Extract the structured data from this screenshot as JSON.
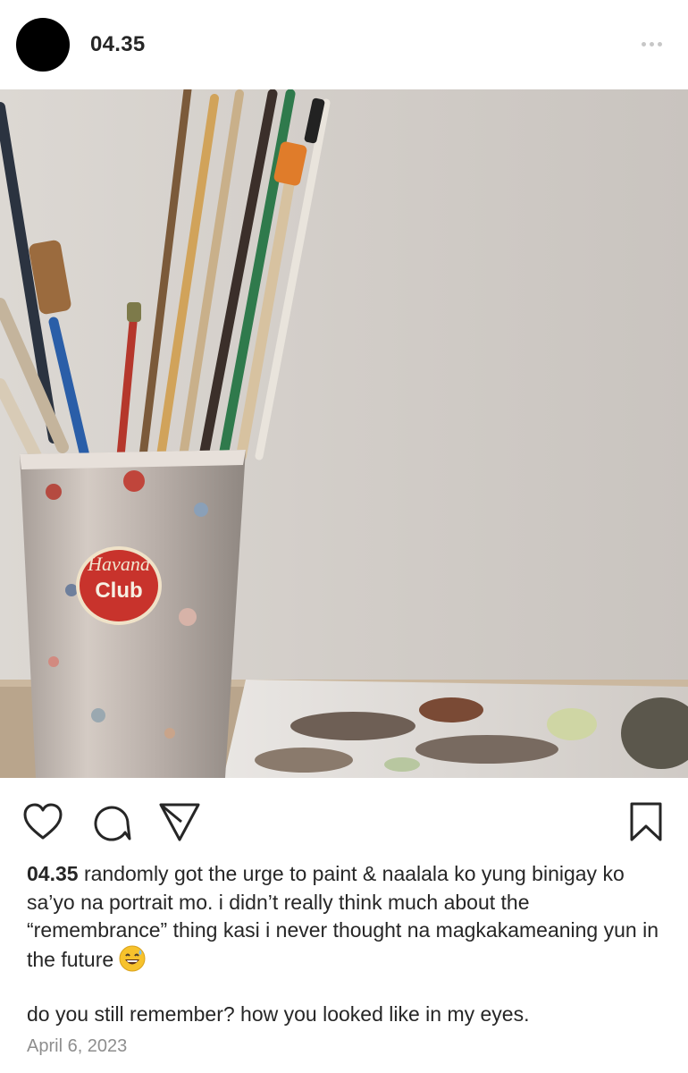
{
  "post": {
    "username": "04.35",
    "caption_username": "04.35",
    "caption_text": "randomly got the urge to paint & naalala ko yung binigay ko sa’yo na portrait mo. i didn’t really think much about the “remembrance” thing kasi i never thought na magkakameaning yun in the future",
    "caption_emoji": "grinning-face-with-sweat-emoji",
    "caption_followup": "do you still remember? how you looked like in my eyes.",
    "date": "April 6, 2023"
  },
  "photo": {
    "subject": "paintbrushes in a paint-splattered cup with a palette",
    "cup_logo_line1": "Havana",
    "cup_logo_line2": "Club"
  },
  "icons": {
    "more": "more-options-icon",
    "like": "heart-icon",
    "comment": "comment-bubble-icon",
    "share": "paper-plane-icon",
    "save": "bookmark-icon"
  },
  "colors": {
    "text": "#262626",
    "secondary": "#8e8e8e",
    "background": "#ffffff"
  }
}
